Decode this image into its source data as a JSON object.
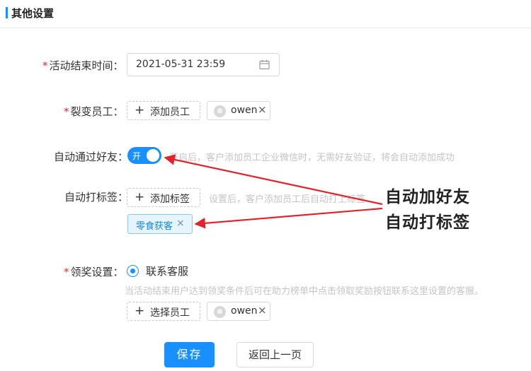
{
  "section": {
    "title": "其他设置"
  },
  "end_time": {
    "label": "活动结束时间：",
    "value": "2021-05-31 23:59"
  },
  "fission_staff": {
    "label": "裂变员工：",
    "add_label": "添加员工",
    "chip_name": "owen",
    "chip_remove": "×"
  },
  "auto_accept": {
    "label": "自动通过好友：",
    "switch_text": "开",
    "hint": "开启后，客户添加员工企业微信时，无需好友验证，将会自动添加成功"
  },
  "auto_tag": {
    "label": "自动打标签：",
    "add_label": "添加标签",
    "hint": "设置后，客户添加员工后自动打上标签",
    "tag": "零食获客",
    "tag_remove": "×"
  },
  "prize": {
    "label": "领奖设置：",
    "option": "联系客服",
    "hint": "当活动结束用户达到领奖条件后可在助力榜单中点击领取奖励按钮联系这里设置的客服。",
    "add_label": "选择员工",
    "chip_name": "owen",
    "chip_remove": "×"
  },
  "actions": {
    "save": "保存",
    "back": "返回上一页"
  },
  "annotations": {
    "line1": "自动加好友",
    "line2": "自动打标签",
    "color": "#e0242c"
  },
  "colors": {
    "primary": "#1890ff",
    "required": "#f5222d"
  }
}
